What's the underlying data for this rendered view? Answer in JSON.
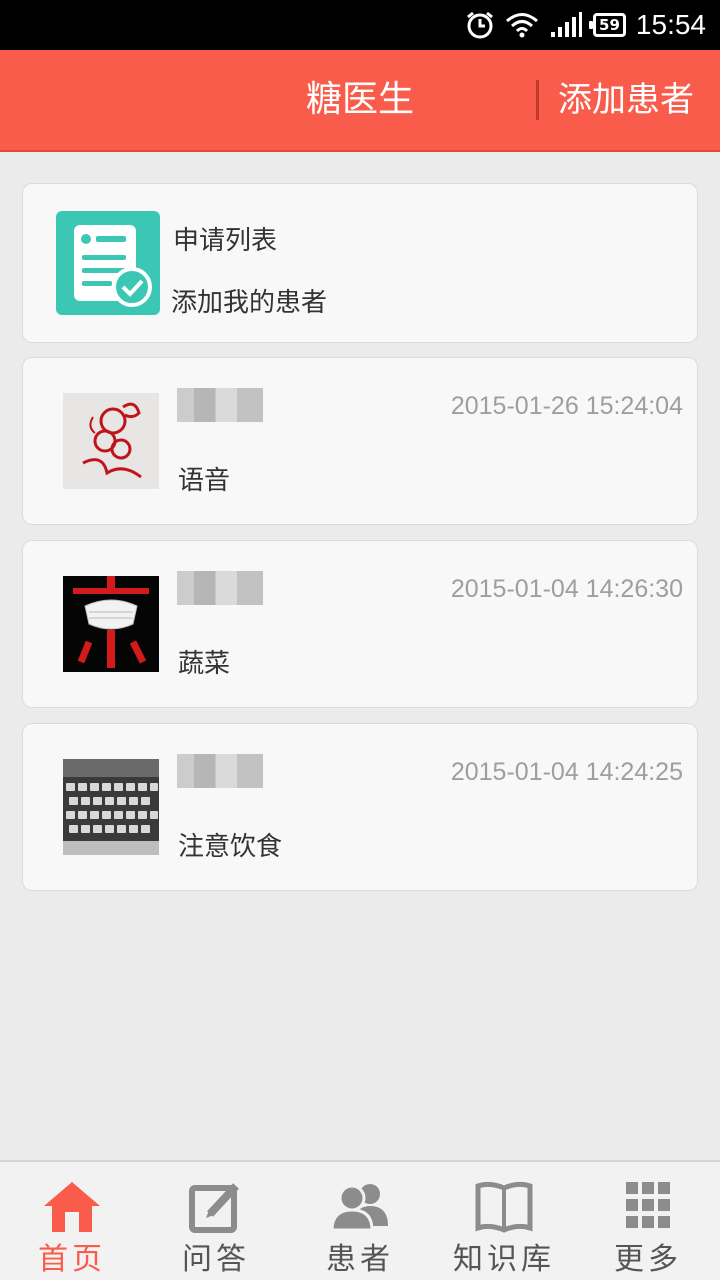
{
  "status_bar": {
    "battery": "59",
    "time": "15:54"
  },
  "header": {
    "title": "糖医生",
    "add_patient": "添加患者"
  },
  "apply_card": {
    "line1": "申请列表",
    "line2": "添加我的患者"
  },
  "messages": [
    {
      "time": "2015-01-26 15:24:04",
      "text": "语音"
    },
    {
      "time": "2015-01-04 14:26:30",
      "text": "蔬菜"
    },
    {
      "time": "2015-01-04 14:24:25",
      "text": "注意饮食"
    }
  ],
  "nav": [
    {
      "label": "首页",
      "icon": "home-icon",
      "active": true
    },
    {
      "label": "问答",
      "icon": "edit-icon",
      "active": false
    },
    {
      "label": "患者",
      "icon": "patients-icon",
      "active": false
    },
    {
      "label": "知识库",
      "icon": "book-icon",
      "active": false
    },
    {
      "label": "更多",
      "icon": "grid-icon",
      "active": false
    }
  ],
  "colors": {
    "accent": "#fa5c4b",
    "teal": "#3cc7b5",
    "muted": "#9e9e9e"
  }
}
